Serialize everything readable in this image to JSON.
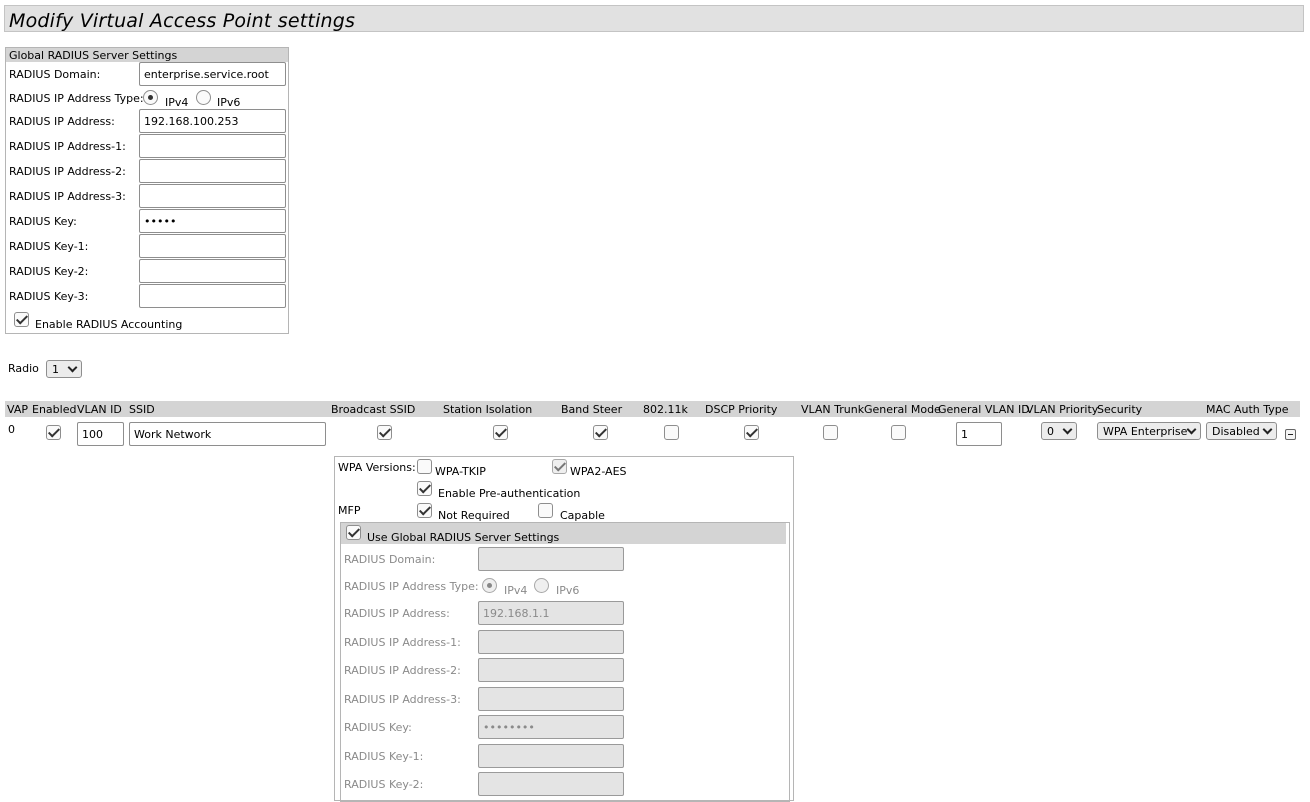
{
  "page": {
    "title": "Modify Virtual Access Point settings"
  },
  "global_radius": {
    "legend": "Global RADIUS Server Settings",
    "domain_label": "RADIUS Domain:",
    "domain_value": "enterprise.service.root",
    "ip_type_label": "RADIUS IP Address Type:",
    "ipv4_label": "IPv4",
    "ipv6_label": "IPv6",
    "ip_type_selected": "IPv4",
    "ip_label": "RADIUS IP Address:",
    "ip_value": "192.168.100.253",
    "ip1_label": "RADIUS IP Address-1:",
    "ip1_value": "",
    "ip2_label": "RADIUS IP Address-2:",
    "ip2_value": "",
    "ip3_label": "RADIUS IP Address-3:",
    "ip3_value": "",
    "key_label": "RADIUS Key:",
    "key_value": "•••••",
    "key1_label": "RADIUS Key-1:",
    "key1_value": "",
    "key2_label": "RADIUS Key-2:",
    "key2_value": "",
    "key3_label": "RADIUS Key-3:",
    "key3_value": "",
    "accounting_label": "Enable RADIUS Accounting",
    "accounting_checked": true
  },
  "radio": {
    "label": "Radio",
    "value": "1"
  },
  "vap_table": {
    "headers": {
      "vap": "VAP",
      "enabled": "Enabled",
      "vlan_id": "VLAN ID",
      "ssid": "SSID",
      "broadcast_ssid": "Broadcast SSID",
      "station_isolation": "Station Isolation",
      "band_steer": "Band Steer",
      "dot11k": "802.11k",
      "dscp_priority": "DSCP Priority",
      "vlan_trunk": "VLAN Trunk",
      "general_mode": "General Mode",
      "general_vlan_id": "General VLAN ID",
      "vlan_priority": "VLAN Priority",
      "security": "Security",
      "mac_auth_type": "MAC Auth Type"
    },
    "row": {
      "vap": "0",
      "enabled": true,
      "vlan_id": "100",
      "ssid": "Work Network",
      "broadcast_ssid": true,
      "station_isolation": true,
      "band_steer": true,
      "dot11k": false,
      "dscp_priority": true,
      "vlan_trunk": false,
      "general_mode": false,
      "general_vlan_id": "1",
      "vlan_priority": "0",
      "security": "WPA Enterprise",
      "mac_auth_type": "Disabled"
    }
  },
  "security_panel": {
    "wpa_versions_label": "WPA Versions:",
    "wpa_tkip_label": "WPA-TKIP",
    "wpa_tkip_checked": false,
    "wpa2_aes_label": "WPA2-AES",
    "wpa2_aes_checked": true,
    "preauth_label": "Enable Pre-authentication",
    "preauth_checked": true,
    "mfp_label": "MFP",
    "not_required_label": "Not Required",
    "not_required_checked": true,
    "capable_label": "Capable",
    "capable_checked": false,
    "use_global_label": "Use Global RADIUS Server Settings",
    "use_global_checked": true,
    "radius": {
      "domain_label": "RADIUS Domain:",
      "domain_value": "",
      "ip_type_label": "RADIUS IP Address Type:",
      "ipv4_label": "IPv4",
      "ipv6_label": "IPv6",
      "ip_type_selected": "IPv4",
      "ip_label": "RADIUS IP Address:",
      "ip_value": "192.168.1.1",
      "ip1_label": "RADIUS IP Address-1:",
      "ip1_value": "",
      "ip2_label": "RADIUS IP Address-2:",
      "ip2_value": "",
      "ip3_label": "RADIUS IP Address-3:",
      "ip3_value": "",
      "key_label": "RADIUS Key:",
      "key_value": "••••••••",
      "key1_label": "RADIUS Key-1:",
      "key1_value": "",
      "key2_label": "RADIUS Key-2:",
      "key2_value": ""
    }
  }
}
